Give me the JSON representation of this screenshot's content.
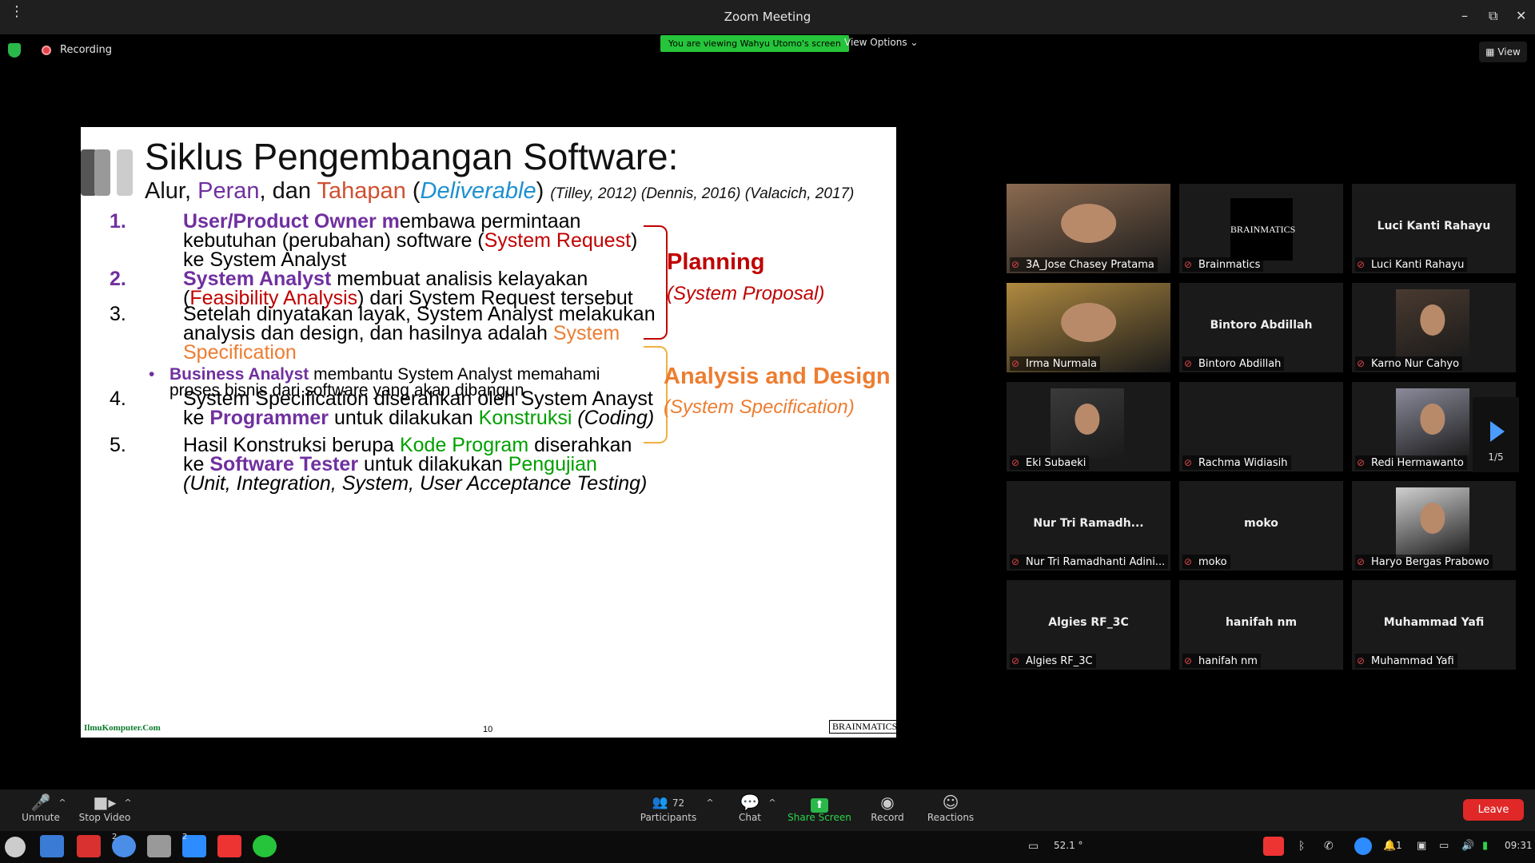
{
  "window": {
    "title": "Zoom Meeting",
    "menu_icon": "kebab-icon",
    "minimize": "–",
    "maximize": "⧉",
    "close": "✕"
  },
  "topbar": {
    "recording_label": "Recording",
    "viewing_banner": "You are viewing Wahyu Utomo's screen",
    "view_options": "View Options",
    "view_button": "View"
  },
  "slide": {
    "title": "Siklus Pengembangan Software:",
    "subtitle_parts": [
      "Alur",
      ", ",
      "Peran",
      ", dan ",
      "Tahapan",
      " (",
      "Deliverable",
      ")"
    ],
    "references": "(Tilley, 2012) (Dennis, 2016) (Valacich, 2017)",
    "items": [
      {
        "num": "1.",
        "lines": [
          [
            {
              "t": "User/Product Owner m",
              "c": "purple"
            },
            {
              "t": "embawa permintaan",
              "c": ""
            }
          ],
          [
            {
              "t": "kebutuhan (perubahan) software (",
              "c": ""
            },
            {
              "t": "System Request",
              "c": "red"
            },
            {
              "t": ")",
              "c": ""
            }
          ],
          [
            {
              "t": "ke System Analyst",
              "c": ""
            }
          ]
        ]
      },
      {
        "num": "2.",
        "lines": [
          [
            {
              "t": "System Analyst",
              "c": "purple"
            },
            {
              "t": " membuat analisis kelayakan",
              "c": ""
            }
          ],
          [
            {
              "t": "(",
              "c": ""
            },
            {
              "t": "Feasibility Analysis",
              "c": "red"
            },
            {
              "t": ") dari System Request tersebut",
              "c": ""
            }
          ]
        ]
      },
      {
        "num": "3.",
        "lines": [
          [
            {
              "t": "Setelah dinyatakan layak, System Analyst melakukan",
              "c": ""
            }
          ],
          [
            {
              "t": "analysis dan design, dan hasilnya adalah ",
              "c": ""
            },
            {
              "t": "System",
              "c": "orange"
            }
          ],
          [
            {
              "t": "Specification",
              "c": "orange"
            }
          ]
        ]
      },
      {
        "num": "4.",
        "lines": [
          [
            {
              "t": "System Specification diserahkan oleh System Anayst",
              "c": ""
            }
          ],
          [
            {
              "t": "ke ",
              "c": ""
            },
            {
              "t": "Programmer",
              "c": "purple"
            },
            {
              "t": " untuk dilakukan ",
              "c": ""
            },
            {
              "t": "Konstruksi",
              "c": "green"
            },
            {
              "t": " (Coding)",
              "c": ""
            }
          ]
        ]
      },
      {
        "num": "5.",
        "lines": [
          [
            {
              "t": "Hasil Konstruksi berupa ",
              "c": ""
            },
            {
              "t": "Kode Program",
              "c": "green"
            },
            {
              "t": " diserahkan",
              "c": ""
            }
          ],
          [
            {
              "t": "ke ",
              "c": ""
            },
            {
              "t": "Software Tester",
              "c": "purple"
            },
            {
              "t": " untuk dilakukan ",
              "c": ""
            },
            {
              "t": "Pengujian",
              "c": "green"
            }
          ],
          [
            {
              "t": "(Unit, Integration, System, User Acceptance Testing)",
              "c": ""
            }
          ]
        ]
      }
    ],
    "sub_bullet": {
      "bullet": "•",
      "lines": [
        [
          {
            "t": "Business Analyst",
            "c": "purple"
          },
          {
            "t": " membantu System Analyst memahami",
            "c": ""
          }
        ],
        [
          {
            "t": "proses bisnis dari software yang akan dibangun",
            "c": ""
          }
        ]
      ]
    },
    "phases": [
      {
        "name": "Planning",
        "deliverable": "(System Proposal)",
        "color": "#c00000"
      },
      {
        "name": "Analysis and Design",
        "deliverable": "(System Specification)",
        "color": "#ed7d31"
      }
    ],
    "footer_left": "IlmuKomputer.Com",
    "page_number": "10",
    "footer_right": "BRAINMATICS"
  },
  "participants": [
    {
      "name": "3A_Jose Chasey Pratama",
      "display": "",
      "video": true
    },
    {
      "name": "Brainmatics",
      "display": "BRAINMATICS",
      "video": false
    },
    {
      "name": "Luci Kanti Rahayu",
      "display": "Luci Kanti Rahayu",
      "video": false
    },
    {
      "name": "Irma Nurmala",
      "display": "",
      "video": true
    },
    {
      "name": "Bintoro Abdillah",
      "display": "Bintoro Abdillah",
      "video": false
    },
    {
      "name": "Karno Nur Cahyo",
      "display": "",
      "video": true
    },
    {
      "name": "Eki Subaeki",
      "display": "",
      "video": true
    },
    {
      "name": "Rachma Widiasih",
      "display": "",
      "video": false
    },
    {
      "name": "Redi Hermawanto",
      "display": "",
      "video": true
    },
    {
      "name": "Nur Tri Ramadhanti Adini...",
      "display": "Nur Tri Ramadh...",
      "video": false
    },
    {
      "name": "moko",
      "display": "moko",
      "video": false
    },
    {
      "name": "Haryo Bergas Prabowo",
      "display": "",
      "video": true
    },
    {
      "name": "Algies RF_3C",
      "display": "Algies RF_3C",
      "video": false
    },
    {
      "name": "hanifah nm",
      "display": "hanifah nm",
      "video": false
    },
    {
      "name": "Muhammad Yafi",
      "display": "Muhammad Yafi",
      "video": false
    }
  ],
  "gallery_page": "1/5",
  "toolbar": {
    "unmute": "Unmute",
    "stop_video": "Stop Video",
    "participants": "Participants",
    "participant_count": "72",
    "chat": "Chat",
    "share_screen": "Share Screen",
    "record": "Record",
    "reactions": "Reactions",
    "leave": "Leave"
  },
  "taskbar": {
    "badge_chrome": "2",
    "badge_zoom": "2",
    "temperature": "52.1 °",
    "notif_count": "1",
    "clock": "09:31"
  }
}
